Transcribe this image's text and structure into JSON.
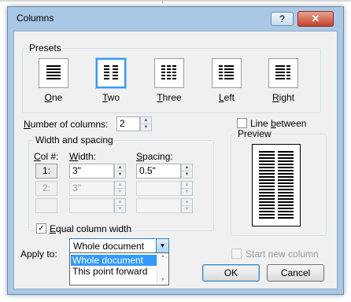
{
  "window": {
    "title": "Columns",
    "help_label": "?",
    "close_label": "✕"
  },
  "presets": {
    "group_label": "Presets",
    "items": [
      {
        "label": "One",
        "underline": "O",
        "rest": "ne"
      },
      {
        "label": "Two",
        "underline": "T",
        "rest": "wo",
        "selected": true
      },
      {
        "label": "Three",
        "underline": "T",
        "rest": "hree"
      },
      {
        "label": "Left",
        "underline": "L",
        "rest": "eft"
      },
      {
        "label": "Right",
        "underline": "R",
        "rest": "ight"
      }
    ]
  },
  "number_of_columns": {
    "label_u": "N",
    "label_rest": "umber of columns:",
    "value": "2"
  },
  "line_between": {
    "label_pre": "Line ",
    "label_u": "b",
    "label_rest": "etween",
    "checked": false
  },
  "width_spacing": {
    "group_label": "Width and spacing",
    "col_header_u": "C",
    "col_header_rest": "ol #:",
    "width_header_u": "W",
    "width_header_rest": "idth:",
    "spacing_header_u": "S",
    "spacing_header_rest": "pacing:",
    "rows": [
      {
        "col": "1:",
        "width": "3\"",
        "spacing": "0.5\""
      },
      {
        "col": "2:",
        "width": "3\"",
        "spacing": ""
      },
      {
        "col": "",
        "width": "",
        "spacing": ""
      }
    ]
  },
  "equal_width": {
    "label_u": "E",
    "label_rest": "qual column width",
    "checked": true
  },
  "preview": {
    "label": "Preview"
  },
  "apply_to": {
    "label_pre": "Apply to:",
    "value": "Whole document",
    "options": [
      "Whole document",
      "This point forward"
    ]
  },
  "start_new_column": {
    "label": "Start new column",
    "checked": false
  },
  "buttons": {
    "ok": "OK",
    "cancel": "Cancel"
  },
  "colors": {
    "accent": "#3399ff",
    "title_bar": "#a8c8e6",
    "close": "#c5432a"
  }
}
